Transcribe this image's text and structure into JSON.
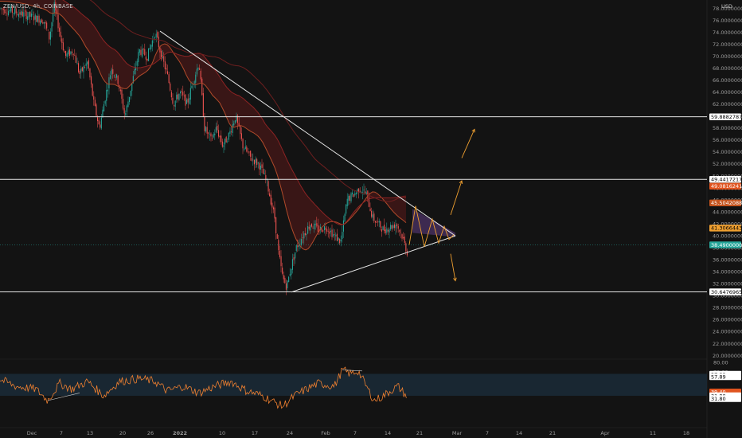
{
  "symbol": "ZEN/USD, 4h, COINBASE",
  "currency": "USD",
  "price_axis": {
    "labels": [
      "78.00000000",
      "76.00000000",
      "74.00000000",
      "72.00000000",
      "70.00000000",
      "68.00000000",
      "66.00000000",
      "64.00000000",
      "62.00000000",
      "60.00000000",
      "58.00000000",
      "56.00000000",
      "54.00000000",
      "52.00000000",
      "50.00000000",
      "48.00000000",
      "46.00000000",
      "44.00000000",
      "42.00000000",
      "40.00000000",
      "38.00000000",
      "36.00000000",
      "34.00000000",
      "32.00000000",
      "30.00000000",
      "28.00000000",
      "26.00000000",
      "24.00000000",
      "22.00000000",
      "20.00000000"
    ],
    "values": [
      78,
      76,
      74,
      72,
      70,
      68,
      66,
      64,
      62,
      60,
      58,
      56,
      54,
      52,
      50,
      48,
      46,
      44,
      42,
      40,
      38,
      36,
      34,
      32,
      30,
      28,
      26,
      24,
      22,
      20
    ]
  },
  "rsi_axis": {
    "labels": [
      "80.00",
      "70.00"
    ],
    "values": [
      80,
      70
    ]
  },
  "time_axis": {
    "labels": [
      "Dec",
      "7",
      "13",
      "20",
      "26",
      "2022",
      "10",
      "17",
      "24",
      "Feb",
      "7",
      "14",
      "21",
      "Mar",
      "7",
      "14",
      "21",
      "Apr",
      "11",
      "18"
    ],
    "bold": [
      false,
      false,
      false,
      false,
      false,
      true,
      false,
      false,
      false,
      false,
      false,
      false,
      false,
      false,
      false,
      false,
      false,
      false,
      false,
      false
    ]
  },
  "price_tags": [
    {
      "text": "59.88827871",
      "value": 59.888,
      "bg": "#ffffff",
      "fg": "#000000"
    },
    {
      "text": "49.44172175",
      "value": 49.44,
      "bg": "#ffffff",
      "fg": "#000000"
    },
    {
      "text": "49.08162414",
      "value": 48.3,
      "bg": "#e0541f",
      "fg": "#ffffff"
    },
    {
      "text": "45.50420888",
      "value": 45.5,
      "bg": "#c4531d",
      "fg": "#ffffff"
    },
    {
      "text": "41.30664431",
      "value": 41.3,
      "bg": "#f0a030",
      "fg": "#000000"
    },
    {
      "text": "38.49000000",
      "value": 38.49,
      "bg": "#26a69a",
      "fg": "#ffffff"
    },
    {
      "text": "30.64769656",
      "value": 30.648,
      "bg": "#ffffff",
      "fg": "#000000"
    }
  ],
  "rsi_tags": [
    {
      "text": "57.89",
      "value": 67.5,
      "bg": "#ffffff",
      "fg": "#000000"
    },
    {
      "text": "57.89",
      "value": 65.0,
      "bg": "#ffffff",
      "fg": "#000000"
    },
    {
      "text": "39.40",
      "value": 49.0,
      "bg": "#e0541f",
      "fg": "#ffffff"
    },
    {
      "text": "31.80",
      "value": 45.0,
      "bg": "#ffffff",
      "fg": "#000000"
    },
    {
      "text": "31.80",
      "value": 42.0,
      "bg": "#ffffff",
      "fg": "#000000"
    }
  ],
  "horizontal_levels": [
    59.888,
    49.44,
    30.648
  ],
  "colors": {
    "background": "#131313",
    "up": "#26a69a",
    "down": "#ef5350",
    "ema_fast": "#b04a2a",
    "ema_slow": "#8c2323",
    "cloud": "#5a1a1a",
    "wedge_fill": "#5a3a7a",
    "projection": "#f0a030",
    "rsi_line": "#f08030",
    "rsi_band": "#1b2a36"
  }
}
